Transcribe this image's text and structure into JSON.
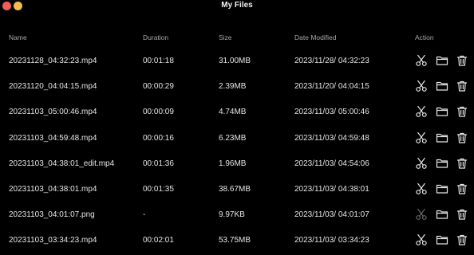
{
  "window": {
    "title": "My Files"
  },
  "columns": {
    "name": "Name",
    "duration": "Duration",
    "size": "Size",
    "date_modified": "Date Modified",
    "action": "Action"
  },
  "files": [
    {
      "name": "20231128_04:32:23.mp4",
      "duration": "00:01:18",
      "size": "31.00MB",
      "modified": "2023/11/28/ 04:32:23",
      "cut_enabled": true
    },
    {
      "name": "20231120_04:04:15.mp4",
      "duration": "00:00:29",
      "size": "2.39MB",
      "modified": "2023/11/20/ 04:04:15",
      "cut_enabled": true
    },
    {
      "name": "20231103_05:00:46.mp4",
      "duration": "00:00:09",
      "size": "4.74MB",
      "modified": "2023/11/03/ 05:00:46",
      "cut_enabled": true
    },
    {
      "name": "20231103_04:59:48.mp4",
      "duration": "00:00:16",
      "size": "6.23MB",
      "modified": "2023/11/03/ 04:59:48",
      "cut_enabled": true
    },
    {
      "name": "20231103_04:38:01_edit.mp4",
      "duration": "00:01:36",
      "size": "1.96MB",
      "modified": "2023/11/03/ 04:54:06",
      "cut_enabled": true
    },
    {
      "name": "20231103_04:38:01.mp4",
      "duration": "00:01:35",
      "size": "38.67MB",
      "modified": "2023/11/03/ 04:38:01",
      "cut_enabled": true
    },
    {
      "name": "20231103_04:01:07.png",
      "duration": "-",
      "size": "9.97KB",
      "modified": "2023/11/03/ 04:01:07",
      "cut_enabled": false
    },
    {
      "name": "20231103_03:34:23.mp4",
      "duration": "00:02:01",
      "size": "53.75MB",
      "modified": "2023/11/03/ 03:34:23",
      "cut_enabled": true
    }
  ],
  "icons": {
    "cut": "scissors-icon",
    "open": "folder-icon",
    "delete": "trash-icon"
  },
  "colors": {
    "background": "#000000",
    "close": "#ee5f57",
    "minimize": "#f4bd4f",
    "header_text": "#a8a8a8",
    "row_text": "#e6e6e6"
  }
}
